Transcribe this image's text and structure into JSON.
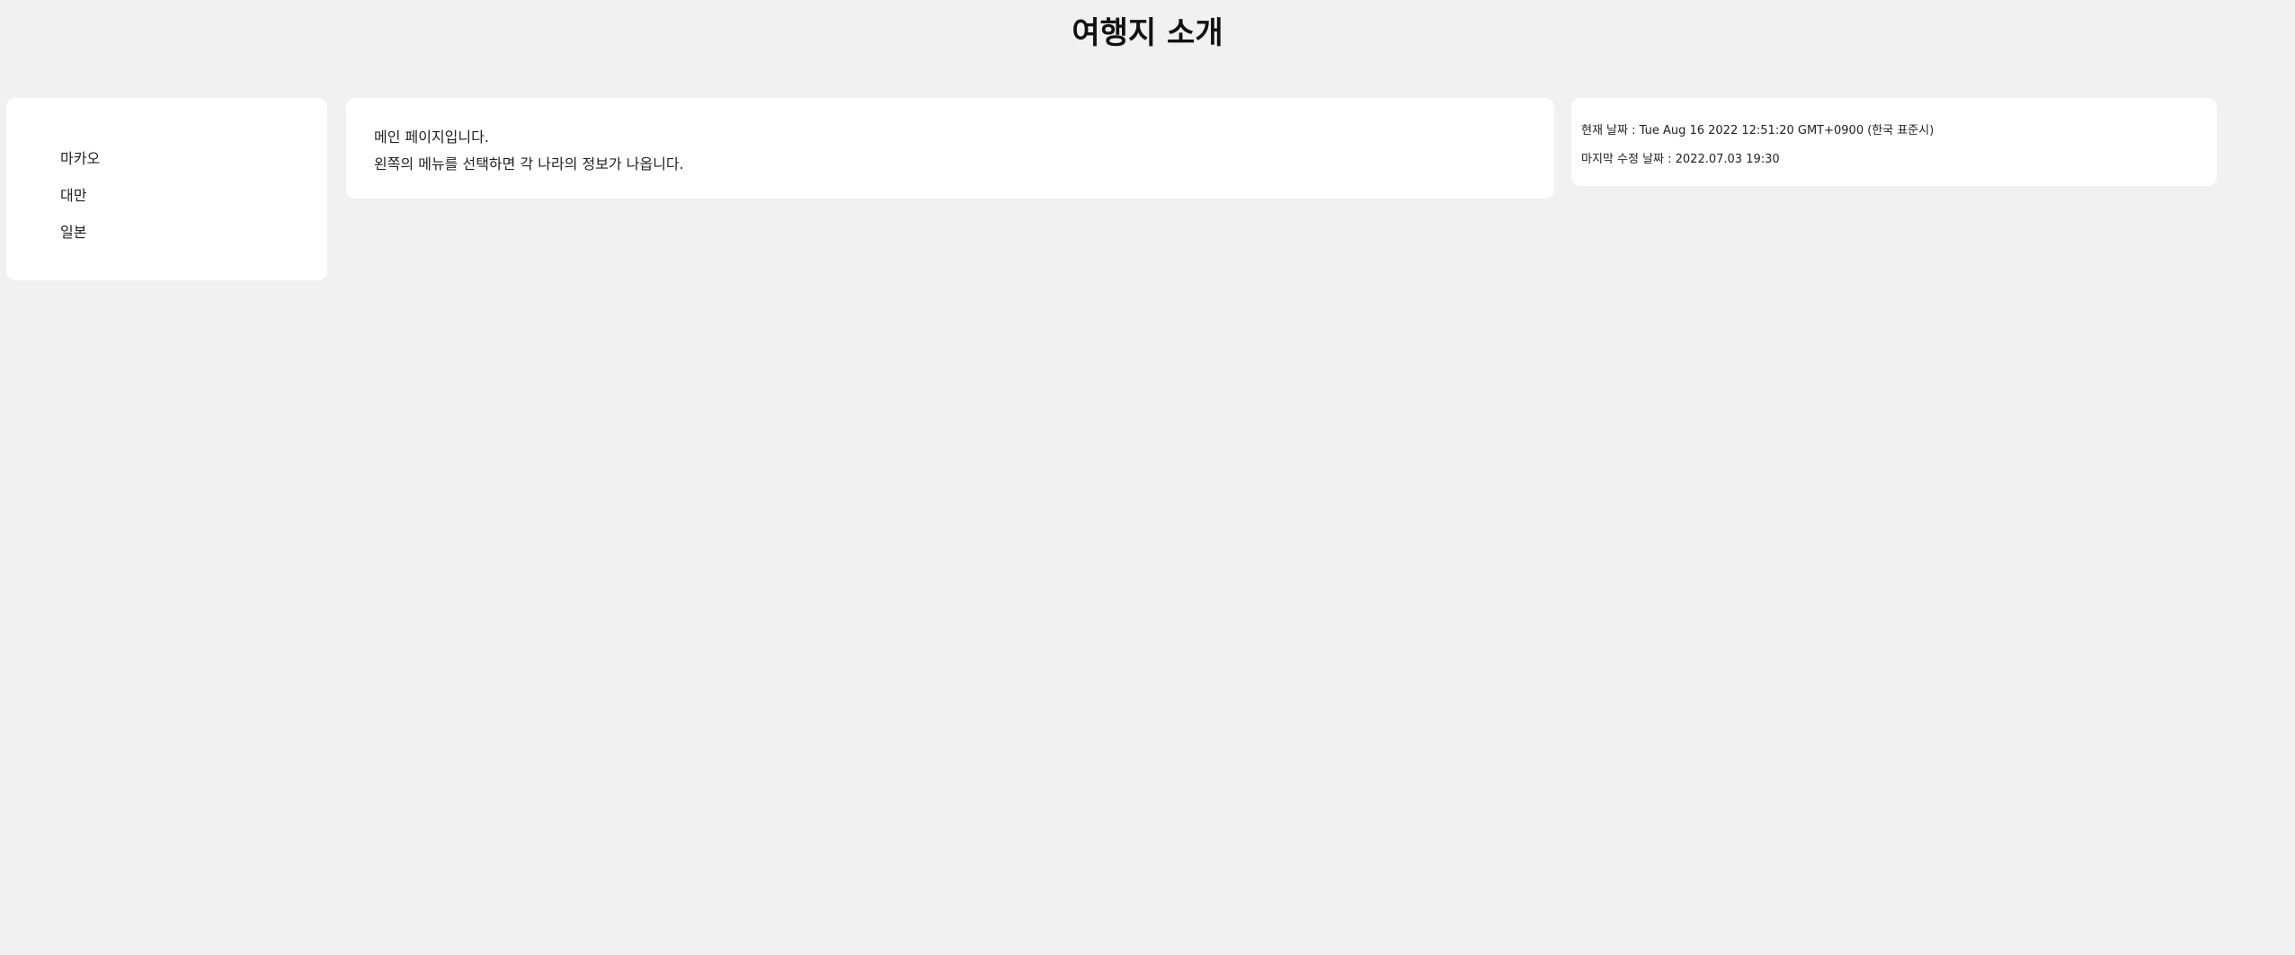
{
  "header": {
    "title": "여행지 소개"
  },
  "sidebar": {
    "items": [
      {
        "label": "마카오"
      },
      {
        "label": "대만"
      },
      {
        "label": "일본"
      }
    ]
  },
  "main": {
    "line1": "메인 페이지입니다.",
    "line2": "왼쪽의 메뉴를 선택하면 각 나라의 정보가 나옵니다."
  },
  "info": {
    "current_date": "현재 날짜 : Tue Aug 16 2022 12:51:20 GMT+0900 (한국 표준시)",
    "last_modified": "마지막 수정 날짜 : 2022.07.03 19:30"
  }
}
